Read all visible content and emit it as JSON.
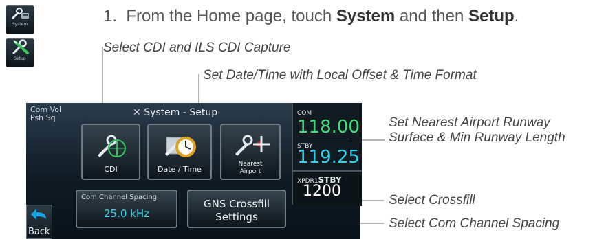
{
  "step": {
    "number": "1.",
    "prefix": "From the Home page, touch ",
    "bold1": "System",
    "middle": " and then ",
    "bold2": "Setup",
    "suffix": "."
  },
  "side_icons": {
    "system_caption": "System",
    "setup_caption": "Setup"
  },
  "callouts": {
    "cdi": "Select CDI and ILS CDI Capture",
    "date_time": "Set Date/Time with Local Offset & Time Format",
    "nearest_line1": "Set Nearest Airport Runway",
    "nearest_line2": "Surface & Min Runway Length",
    "crossfill": "Select Crossfill",
    "com_spacing": "Select Com Channel Spacing"
  },
  "screen": {
    "status_line1": "Com Vol",
    "status_line2": "Psh Sq",
    "title": "System - Setup",
    "buttons": {
      "cdi": "CDI",
      "date_time": "Date / Time",
      "nearest_line1": "Nearest",
      "nearest_line2": "Airport",
      "com_spacing_label": "Com Channel Spacing",
      "com_spacing_value": "25.0 kHz",
      "crossfill_line1": "GNS Crossfill",
      "crossfill_line2": "Settings",
      "back": "Back"
    },
    "radio": {
      "com_label": "COM",
      "com_freq": "118.00",
      "stby_label": "STBY",
      "stby_freq": "119.25",
      "xpdr_label": "XPDR1",
      "xpdr_mode": "STBY",
      "xpdr_code": "1200"
    }
  },
  "colors": {
    "com_active": "#3fe07a",
    "stby": "#29d6f0",
    "xpdr": "#ffffff"
  }
}
